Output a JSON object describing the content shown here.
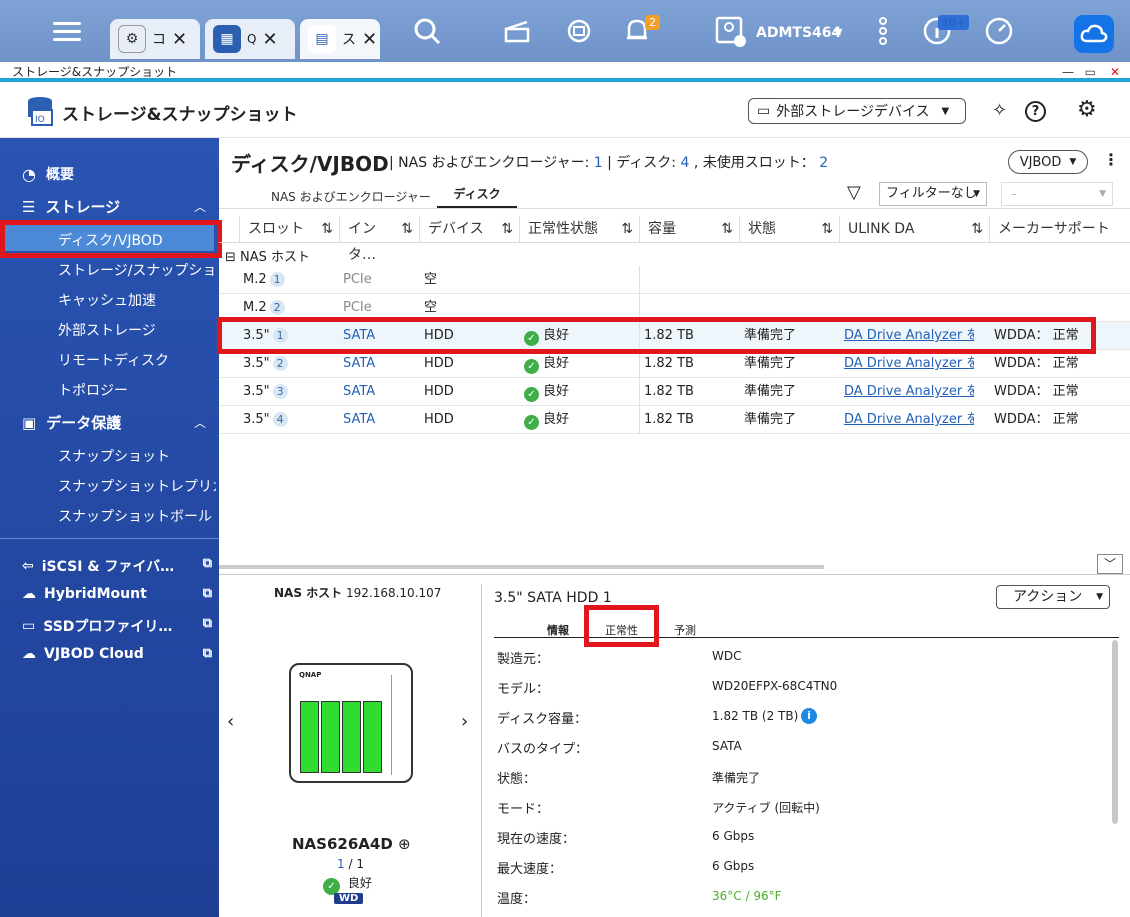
{
  "topbar": {
    "tabs": [
      {
        "label": "コ",
        "icon": "gear-icon"
      },
      {
        "label": "Q",
        "icon": "qts-icon"
      },
      {
        "label": "ス",
        "icon": "storage-icon"
      }
    ],
    "notification_count": "2",
    "user": "ADMTS464",
    "update_count": "10+"
  },
  "window": {
    "title": "ストレージ&スナップショット"
  },
  "app": {
    "title": "ストレージ&スナップショット",
    "external_device_button": "外部ストレージデバイス"
  },
  "sidebar": {
    "overview": "概要",
    "storage": "ストレージ",
    "storage_items": [
      "ディスク/VJBOD",
      "ストレージ/スナップショ…",
      "キャッシュ加速",
      "外部ストレージ",
      "リモートディスク",
      "トポロジー"
    ],
    "data_protection": "データ保護",
    "protection_items": [
      "スナップショット",
      "スナップショットレプリカ",
      "スナップショットボールト"
    ],
    "external_links": [
      "iSCSI & ファイバー…",
      "HybridMount",
      "SSDプロファイリン…",
      "VJBOD Cloud"
    ]
  },
  "main": {
    "title": "ディスク/VJBOD",
    "summary_prefix": "NAS およびエンクロージャー:",
    "enclosures": "1",
    "disks_label": "| ディスク:",
    "disks": "4",
    "unused_label": ", 未使用スロット：",
    "unused_slots": "2",
    "vjbod_button": "VJBOD",
    "tabs": [
      "NAS およびエンクロージャー",
      "ディスク"
    ],
    "filter_label": "フィルターなし",
    "filter_second": "-",
    "columns": [
      "スロット",
      "インタ…",
      "デバイス",
      "正常性状態",
      "容量",
      "状態",
      "ULINK DA",
      "メーカーサポート"
    ],
    "group": "NAS ホスト",
    "rows": [
      {
        "slot": "M.2",
        "n": "1",
        "iface": "PCIe",
        "device": "空",
        "health": "",
        "capacity": "",
        "status": "",
        "ulink": "",
        "support": ""
      },
      {
        "slot": "M.2",
        "n": "2",
        "iface": "PCIe",
        "device": "空",
        "health": "",
        "capacity": "",
        "status": "",
        "ulink": "",
        "support": ""
      },
      {
        "slot": "3.5\"",
        "n": "1",
        "iface": "SATA",
        "device": "HDD",
        "health": "良好",
        "capacity": "1.82 TB",
        "status": "準備完了",
        "ulink": "DA Drive Analyzer を…",
        "support": "WDDA： 正常"
      },
      {
        "slot": "3.5\"",
        "n": "2",
        "iface": "SATA",
        "device": "HDD",
        "health": "良好",
        "capacity": "1.82 TB",
        "status": "準備完了",
        "ulink": "DA Drive Analyzer を…",
        "support": "WDDA： 正常"
      },
      {
        "slot": "3.5\"",
        "n": "3",
        "iface": "SATA",
        "device": "HDD",
        "health": "良好",
        "capacity": "1.82 TB",
        "status": "準備完了",
        "ulink": "DA Drive Analyzer を…",
        "support": "WDDA： 正常"
      },
      {
        "slot": "3.5\"",
        "n": "4",
        "iface": "SATA",
        "device": "HDD",
        "health": "良好",
        "capacity": "1.82 TB",
        "status": "準備完了",
        "ulink": "DA Drive Analyzer を…",
        "support": "WDDA： 正常"
      }
    ]
  },
  "detail": {
    "host_label": "NAS ホスト",
    "host_ip": "192.168.10.107",
    "nas_name": "NAS626A4D",
    "page_current": "1",
    "page_total": "/ 1",
    "nas_health": "良好",
    "brand": "WD",
    "disk_title": "3.5\" SATA HDD 1",
    "action_button": "アクション",
    "tabs": [
      "情報",
      "正常性",
      "予測"
    ],
    "fields": [
      {
        "label": "製造元：",
        "value": "WDC"
      },
      {
        "label": "モデル：",
        "value": "WD20EFPX-68C4TN0"
      },
      {
        "label": "ディスク容量：",
        "value": "1.82 TB (2 TB)"
      },
      {
        "label": "バスのタイプ：",
        "value": "SATA"
      },
      {
        "label": "状態：",
        "value": "準備完了"
      },
      {
        "label": "モード：",
        "value": "アクティブ (回転中)"
      },
      {
        "label": "現在の速度：",
        "value": "6 Gbps"
      },
      {
        "label": "最大速度：",
        "value": "6 Gbps"
      },
      {
        "label": "温度：",
        "value": "36°C / 96°F"
      }
    ],
    "temp_color": "#4caf2a"
  }
}
